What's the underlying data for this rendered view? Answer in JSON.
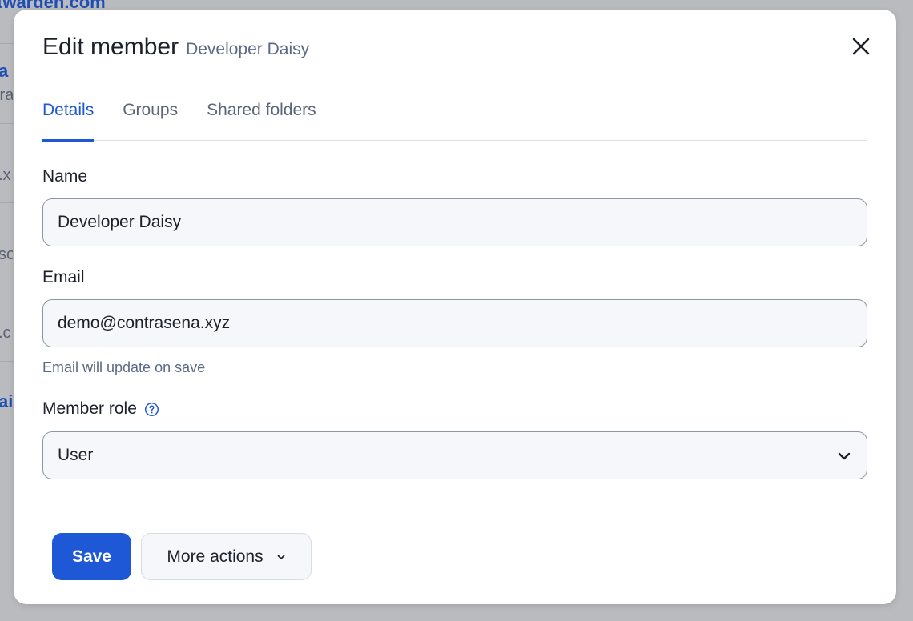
{
  "background": {
    "fragments": [
      "twarden.com",
      "a",
      "tra",
      ".x",
      "so",
      ".c",
      "ai"
    ]
  },
  "modal": {
    "title": "Edit member",
    "subtitle": "Developer Daisy",
    "close_icon": "close-icon",
    "tabs": [
      {
        "label": "Details",
        "active": true
      },
      {
        "label": "Groups",
        "active": false
      },
      {
        "label": "Shared folders",
        "active": false
      }
    ],
    "name_field": {
      "label": "Name",
      "value": "Developer Daisy"
    },
    "email_field": {
      "label": "Email",
      "value": "demo@contrasena.xyz",
      "hint": "Email will update on save"
    },
    "role_field": {
      "label": "Member role",
      "value": "User",
      "help_icon": "question-circle-icon"
    },
    "actions": {
      "save_label": "Save",
      "more_label": "More actions"
    }
  },
  "colors": {
    "accent": "#1e58d6",
    "overlay": "#b9bbbf",
    "subtle_text": "#5a6a86"
  }
}
